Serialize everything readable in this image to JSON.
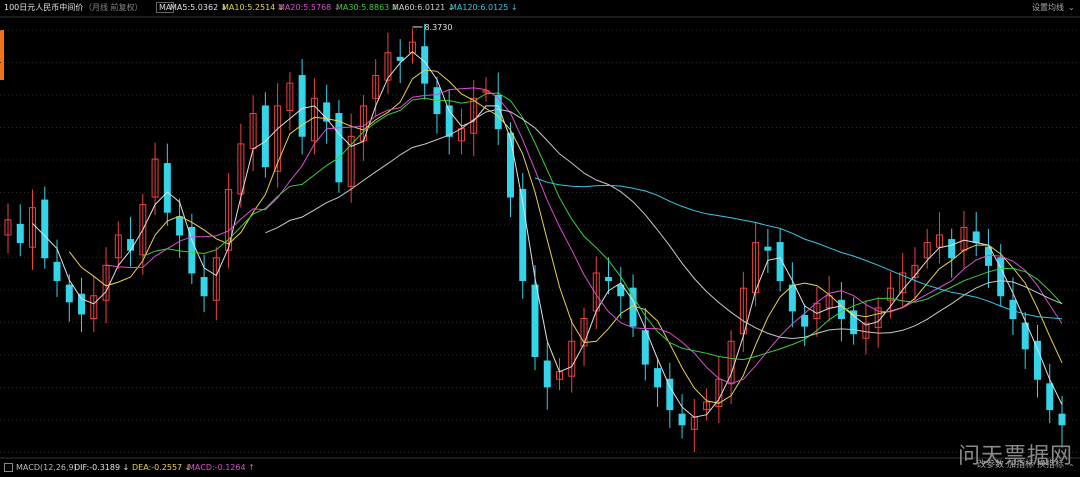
{
  "header": {
    "title": "100日元人民币中间价",
    "subtitle": "（月线 前复权）",
    "indicator_box": "MA",
    "indicators": [
      {
        "label": "MA5:5.0362",
        "arrow": "↓",
        "color": "#e0e0e0"
      },
      {
        "label": "MA10:5.2514",
        "arrow": "↓",
        "color": "#e8d44d"
      },
      {
        "label": "MA20:5.5768",
        "arrow": "↓",
        "color": "#d94fd0"
      },
      {
        "label": "MA30:5.8863",
        "arrow": "↓",
        "color": "#3ccf3c"
      },
      {
        "label": "MA60:6.0121",
        "arrow": "↓",
        "color": "#d0d0d0"
      },
      {
        "label": "MA120:6.0125",
        "arrow": "↓",
        "color": "#38c8e8"
      }
    ],
    "settings_label": "设置均线"
  },
  "footer": {
    "macd_label": "MACD(12,26,9)",
    "values": [
      {
        "label": "DIF:-0.3189",
        "arrow": "↓",
        "color": "#e0e0e0"
      },
      {
        "label": "DEA:-0.2557",
        "arrow": "↓",
        "color": "#e8d44d"
      },
      {
        "label": "MACD:-0.1264",
        "arrow": "↑",
        "color": "#d94fd0"
      }
    ],
    "buttons": [
      "改参数",
      "加指标",
      "换指标"
    ]
  },
  "watermark": "问天票据网",
  "colors": {
    "up": "#f04040",
    "down": "#35d4e8",
    "ma5": "#e0e0e0",
    "ma10": "#e8d44d",
    "ma20": "#d94fd0",
    "ma30": "#3ccf3c",
    "ma60": "#c8c8c8",
    "ma120": "#38c8e8"
  },
  "chart_data": {
    "type": "candlestick",
    "annotations": [
      {
        "label": "8.3730"
      }
    ],
    "close": [
      7.2,
      7.05,
      7.28,
      6.95,
      6.8,
      6.66,
      6.58,
      6.7,
      6.9,
      7.1,
      7.0,
      7.3,
      7.6,
      7.25,
      7.1,
      6.85,
      6.7,
      6.95,
      7.4,
      7.7,
      7.9,
      7.55,
      7.95,
      8.1,
      7.75,
      8.0,
      7.85,
      7.45,
      7.75,
      7.95,
      8.15,
      8.3,
      8.25,
      8.37,
      8.1,
      7.9,
      7.75,
      7.8,
      8.0,
      8.05,
      7.8,
      7.35,
      6.8,
      6.3,
      6.1,
      6.2,
      6.4,
      6.55,
      6.85,
      6.8,
      6.7,
      6.5,
      6.25,
      6.1,
      5.95,
      5.85,
      5.9,
      6.0,
      6.15,
      6.4,
      6.75,
      7.05,
      7.0,
      6.8,
      6.6,
      6.5,
      6.65,
      6.7,
      6.55,
      6.45,
      6.52,
      6.62,
      6.75,
      6.85,
      6.9,
      7.05,
      7.1,
      6.95,
      7.15,
      7.05,
      6.9,
      6.7,
      6.55,
      6.35,
      6.15,
      5.95,
      5.85
    ]
  }
}
